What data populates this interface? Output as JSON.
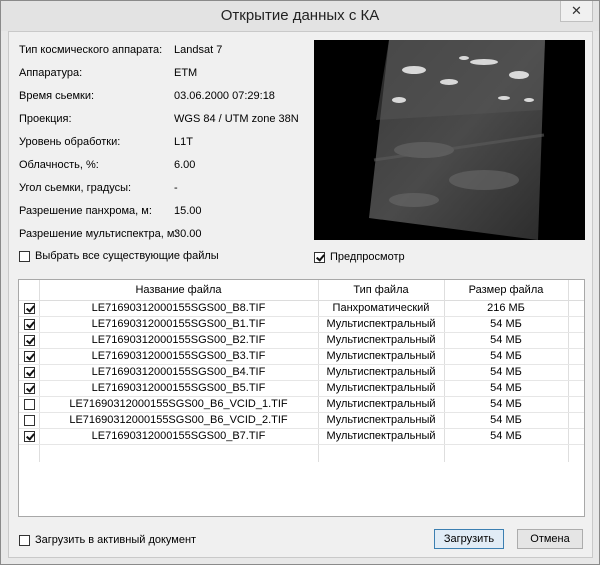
{
  "window": {
    "title": "Открытие данных с КА",
    "close_glyph": "✕"
  },
  "properties": [
    {
      "label": "Тип космического аппарата:",
      "value": "Landsat 7"
    },
    {
      "label": "Аппаратура:",
      "value": "ETM"
    },
    {
      "label": "Время сьемки:",
      "value": "03.06.2000 07:29:18"
    },
    {
      "label": "Проекция:",
      "value": "WGS 84 / UTM zone 38N"
    },
    {
      "label": "Уровень обработки:",
      "value": "L1T"
    },
    {
      "label": "Облачность, %:",
      "value": "6.00"
    },
    {
      "label": "Угол сьемки, градусы:",
      "value": "-"
    },
    {
      "label": "Разрешение панхрома, м:",
      "value": "15.00"
    },
    {
      "label": "Разрешение мультиспектра, м:",
      "value": "30.00"
    }
  ],
  "select_all": {
    "label": "Выбрать все существующие файлы",
    "checked": false
  },
  "preview_toggle": {
    "label": "Предпросмотр",
    "checked": true
  },
  "table": {
    "headers": [
      "Название файла",
      "Тип файла",
      "Размер файла"
    ],
    "rows": [
      {
        "checked": true,
        "name": "LE71690312000155SGS00_B8.TIF",
        "type": "Панхроматический",
        "size": "216 МБ"
      },
      {
        "checked": true,
        "name": "LE71690312000155SGS00_B1.TIF",
        "type": "Мультиспектральный",
        "size": "54 МБ"
      },
      {
        "checked": true,
        "name": "LE71690312000155SGS00_B2.TIF",
        "type": "Мультиспектральный",
        "size": "54 МБ"
      },
      {
        "checked": true,
        "name": "LE71690312000155SGS00_B3.TIF",
        "type": "Мультиспектральный",
        "size": "54 МБ"
      },
      {
        "checked": true,
        "name": "LE71690312000155SGS00_B4.TIF",
        "type": "Мультиспектральный",
        "size": "54 МБ"
      },
      {
        "checked": true,
        "name": "LE71690312000155SGS00_B5.TIF",
        "type": "Мультиспектральный",
        "size": "54 МБ"
      },
      {
        "checked": false,
        "name": "LE71690312000155SGS00_B6_VCID_1.TIF",
        "type": "Мультиспектральный",
        "size": "54 МБ"
      },
      {
        "checked": false,
        "name": "LE71690312000155SGS00_B6_VCID_2.TIF",
        "type": "Мультиспектральный",
        "size": "54 МБ"
      },
      {
        "checked": true,
        "name": "LE71690312000155SGS00_B7.TIF",
        "type": "Мультиспектральный",
        "size": "54 МБ"
      }
    ]
  },
  "load_active": {
    "label": "Загрузить в активный документ",
    "checked": false
  },
  "buttons": {
    "load": "Загрузить",
    "cancel": "Отмена"
  }
}
